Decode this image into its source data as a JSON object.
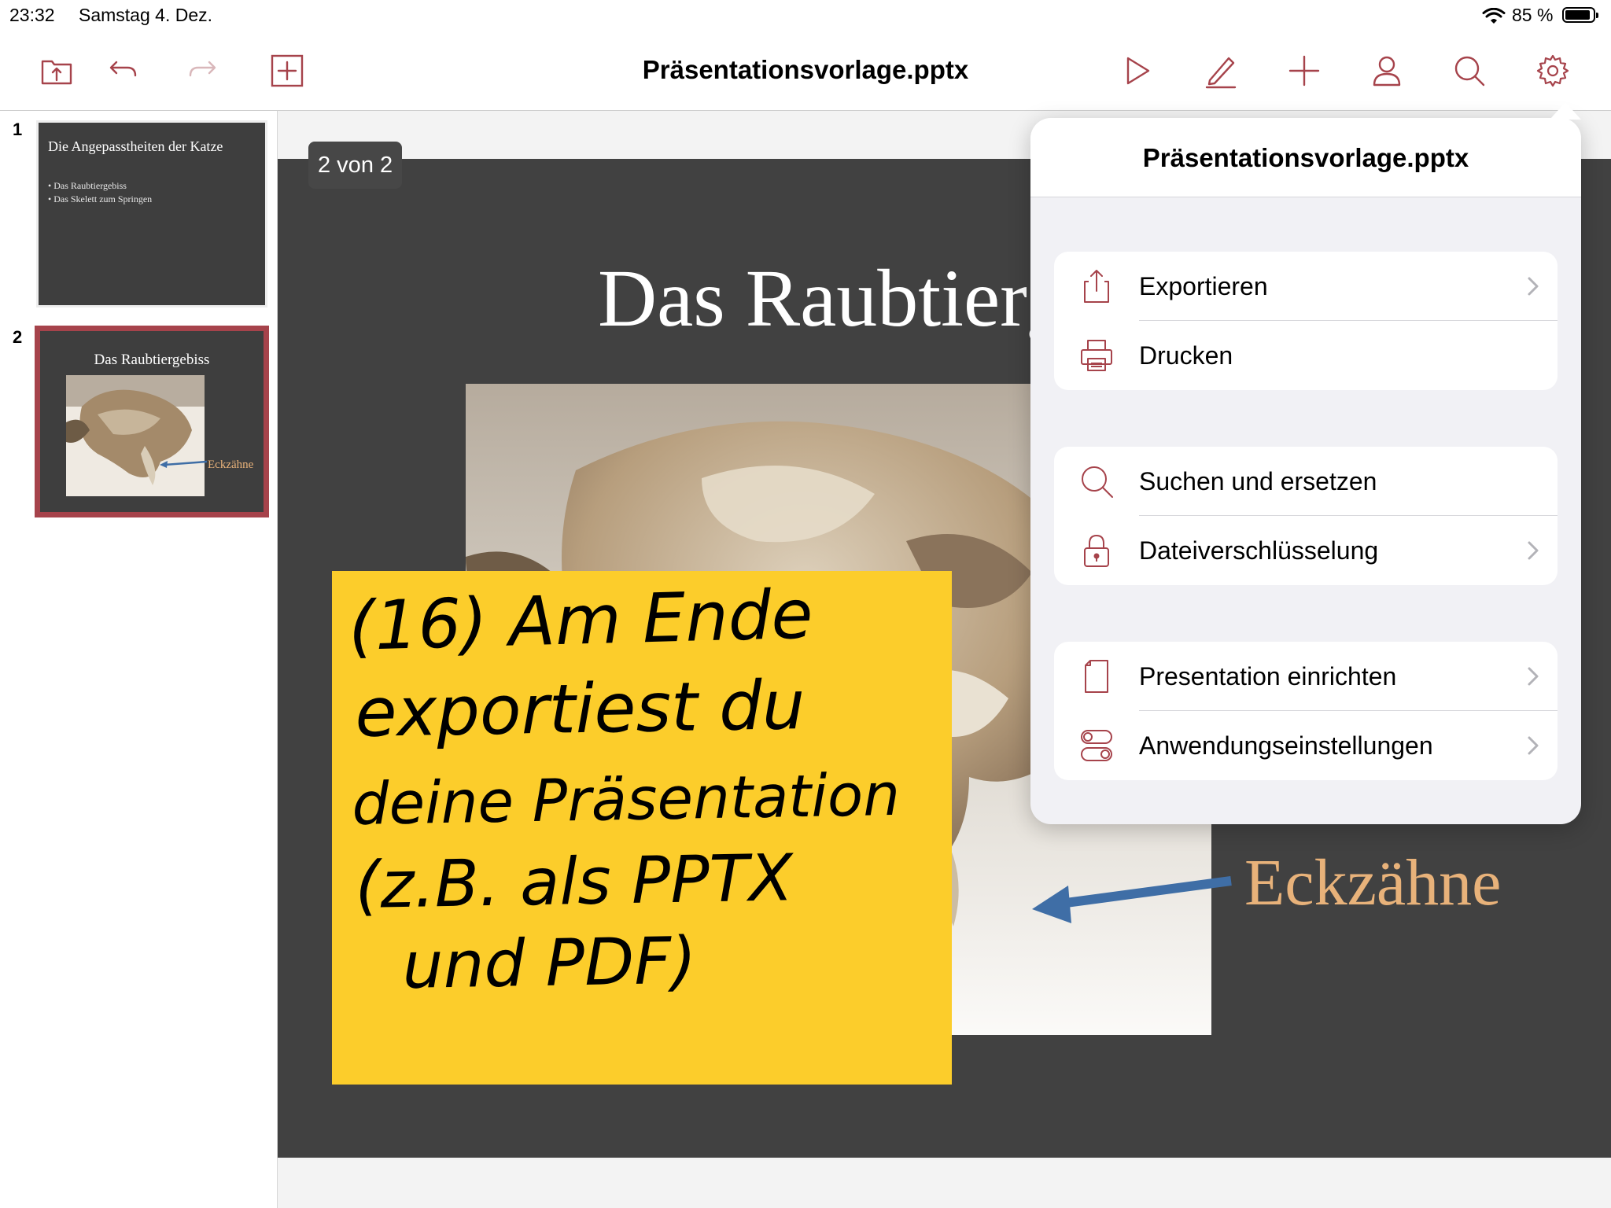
{
  "status_bar": {
    "time": "23:32",
    "date": "Samstag 4. Dez.",
    "battery_percent": "85 %",
    "battery_level": 0.85
  },
  "toolbar": {
    "document_title": "Präsentationsvorlage.pptx"
  },
  "thumbnails": [
    {
      "number": "1",
      "title": "Die Angepasstheiten der Katze",
      "bullets": [
        "• Das Raubtiergebiss",
        "• Das Skelett zum Springen"
      ]
    },
    {
      "number": "2",
      "title": "Das Raubtiergebiss",
      "label": "Eckzähne"
    }
  ],
  "slide": {
    "title": "Das Raubtiergebiss",
    "label": "Eckzähne",
    "page_indicator": "2 von 2"
  },
  "note": {
    "lines": [
      "(16) Am Ende",
      "exportiest du",
      "deine Präsentation",
      "(z.B. als PPTX",
      "und PDF)"
    ]
  },
  "popover": {
    "title": "Präsentationsvorlage.pptx",
    "groups": [
      [
        {
          "label": "Exportieren",
          "icon": "export-icon",
          "chevron": true
        },
        {
          "label": "Drucken",
          "icon": "printer-icon",
          "chevron": false
        }
      ],
      [
        {
          "label": "Suchen und ersetzen",
          "icon": "search-icon",
          "chevron": false
        },
        {
          "label": "Dateiverschlüsselung",
          "icon": "lock-icon",
          "chevron": true
        }
      ],
      [
        {
          "label": "Presentation einrichten",
          "icon": "page-icon",
          "chevron": true
        },
        {
          "label": "Anwendungseinstellungen",
          "icon": "toggles-icon",
          "chevron": true
        }
      ]
    ]
  },
  "colors": {
    "accent": "#a6434b",
    "slide_bg": "#414141",
    "label_orange": "#e8b27a",
    "note_yellow": "#fccd2b",
    "arrow_blue": "#3f6ea6"
  }
}
